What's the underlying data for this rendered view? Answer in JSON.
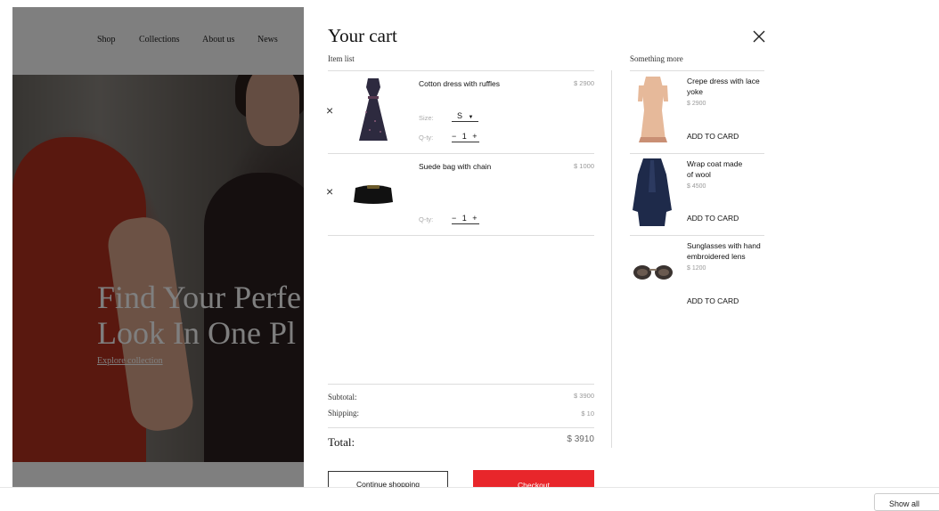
{
  "site": {
    "nav": [
      "Shop",
      "Collections",
      "About us",
      "News"
    ],
    "hero_title_line1": "Find Your Perfe",
    "hero_title_line2": "Look In One Pl",
    "hero_link": "Explore collection"
  },
  "cart": {
    "title": "Your cart",
    "item_list_label": "Item list",
    "items": [
      {
        "name": "Cotton dress with ruffles",
        "price": "$ 2900",
        "size_label": "Size:",
        "size_value": "S",
        "qty_label": "Q-ty:",
        "qty": "− 1 +"
      },
      {
        "name": "Suede bag with chain",
        "price": "$ 1000",
        "qty_label": "Q-ty:",
        "qty": "− 1 +"
      }
    ],
    "remove_symbol": "×",
    "subtotal_label": "Subtotal:",
    "subtotal_value": "$ 3900",
    "shipping_label": "Shipping:",
    "shipping_value": "$ 10",
    "total_label": "Total:",
    "total_value": "$ 3910",
    "continue_label": "Continue shopping",
    "checkout_label": "Checkout",
    "checkout_color": "#e8262b"
  },
  "recommend": {
    "label": "Something more",
    "items": [
      {
        "name_line1": "Crepe dress with lace",
        "name_line2": "yoke",
        "price": "$ 2900",
        "add": "ADD TO CARD"
      },
      {
        "name_line1": "Wrap coat made",
        "name_line2": "of wool",
        "price": "$ 4500",
        "add": "ADD TO CARD"
      },
      {
        "name_line1": "Sunglasses with hand",
        "name_line2": "embroidered lens",
        "price": "$ 1200",
        "add": "ADD TO CARD"
      }
    ]
  },
  "bottom": {
    "show_all": "Show all"
  }
}
